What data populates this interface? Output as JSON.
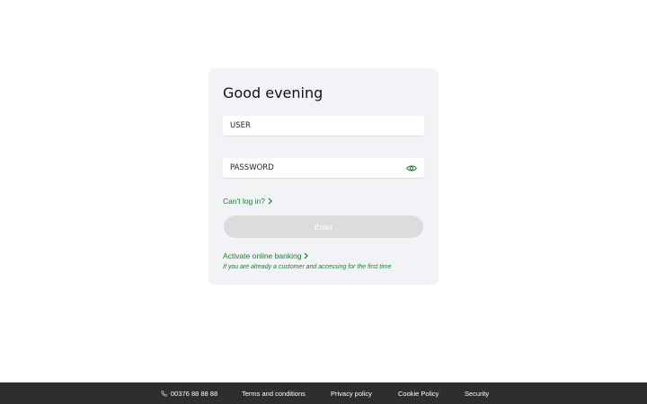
{
  "login": {
    "greeting": "Good evening",
    "user_placeholder": "USER",
    "password_placeholder": "PASSWORD",
    "cant_login": "Can't log in?",
    "enter_label": "Enter",
    "activate_label": "Activate online banking",
    "activate_hint": "If you are already a customer and accessing for the first time"
  },
  "footer": {
    "phone": "00376 88 88 88",
    "terms": "Terms and conditions",
    "privacy": "Privacy policy",
    "cookie": "Cookie Policy",
    "security": "Security"
  },
  "colors": {
    "accent": "#1e7a2e",
    "card_bg": "#f2f3f7",
    "button_disabled": "#dcdcdc",
    "footer_bg": "#2e2e2e"
  },
  "icons": {
    "password_toggle": "eye-icon",
    "link_arrow": "chevron-right-icon",
    "phone": "phone-icon"
  }
}
